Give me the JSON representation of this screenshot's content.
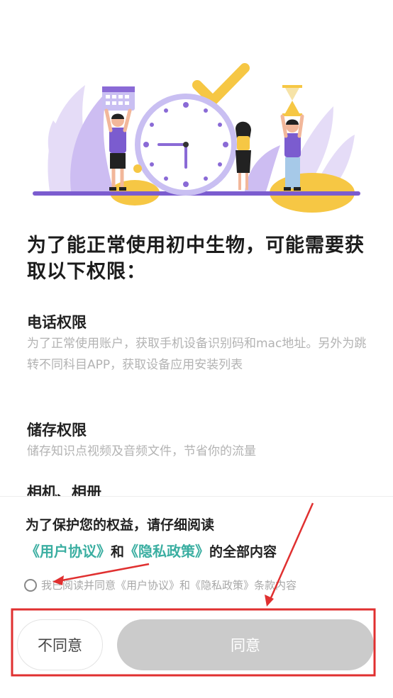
{
  "title": "为了能正常使用初中生物，可能需要获取以下权限：",
  "permissions": [
    {
      "name": "电话权限",
      "desc": "为了正常使用账户，获取手机设备识别码和mac地址。另外为跳转不同科目APP，获取设备应用安装列表"
    },
    {
      "name": "储存权限",
      "desc": "储存知识点视频及音频文件，节省你的流量"
    },
    {
      "name": "相机、相册",
      "desc": ""
    }
  ],
  "consent": {
    "notice": "为了保护您的权益，请仔细阅读",
    "user_agreement": "《用户协议》",
    "and": "和",
    "privacy_policy": "《隐私政策》",
    "suffix": "的全部内容",
    "checkbox_label": "我已阅读并同意《用户协议》和《隐私政策》条款内容",
    "checked": false
  },
  "buttons": {
    "disagree": "不同意",
    "agree": "同意"
  },
  "colors": {
    "accent": "#3aaea1",
    "purple": "#7b5ccf",
    "yellow": "#f6c744",
    "annotation": "#e03030",
    "disabled_button": "#cbcbcb"
  }
}
